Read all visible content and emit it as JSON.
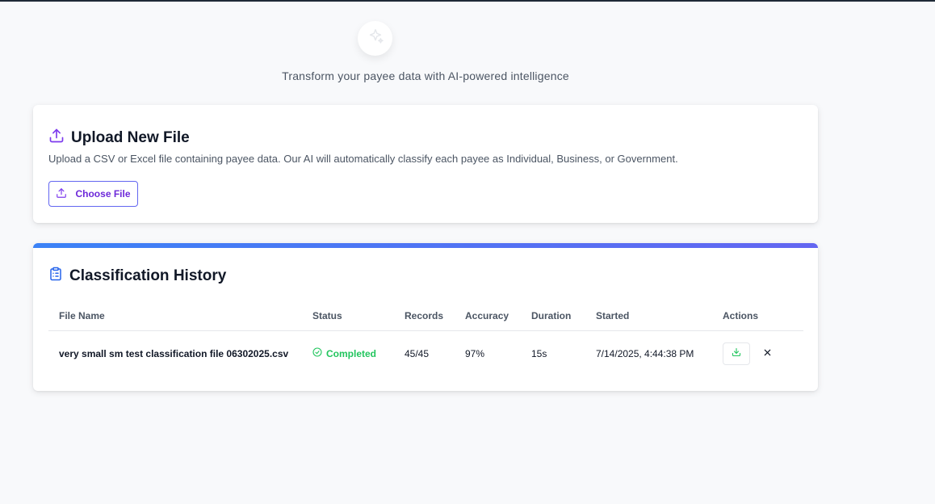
{
  "header": {
    "tagline": "Transform your payee data with AI-powered intelligence",
    "logo_icon": "sparkles-icon"
  },
  "upload": {
    "title": "Upload New File",
    "title_icon": "upload-icon",
    "description": "Upload a CSV or Excel file containing payee data. Our AI will automatically classify each payee as Individual, Business, or Government.",
    "button_label": "Choose File"
  },
  "history": {
    "title": "Classification History",
    "title_icon": "clipboard-list-icon",
    "columns": [
      "File Name",
      "Status",
      "Records",
      "Accuracy",
      "Duration",
      "Started",
      "Actions"
    ],
    "rows": [
      {
        "file_name": "very small sm test classification file 06302025.csv",
        "status": "Completed",
        "records": "45/45",
        "accuracy": "97%",
        "duration": "15s",
        "started": "7/14/2025, 4:44:38 PM"
      }
    ]
  },
  "colors": {
    "accent_purple": "#6d28d9",
    "status_green": "#22c55e",
    "gradient_start": "#3b82f6",
    "gradient_end": "#6366f1"
  }
}
